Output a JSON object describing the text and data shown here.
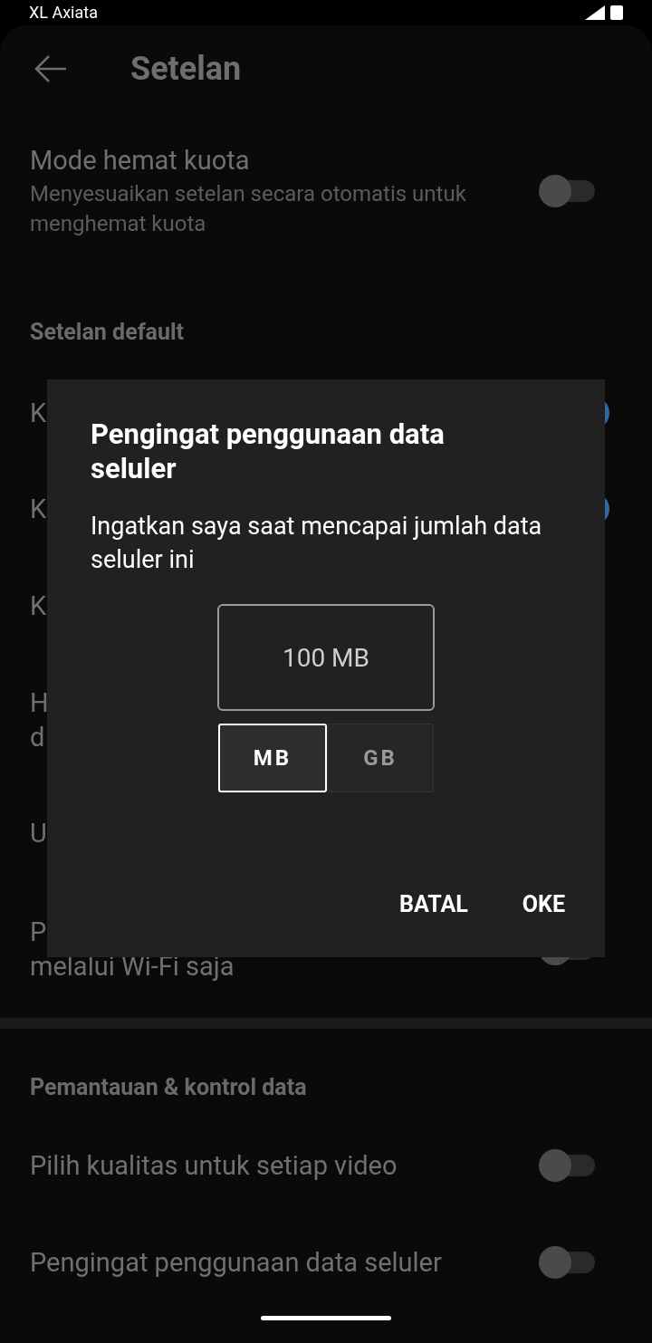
{
  "status_bar": {
    "carrier": "XL Axiata"
  },
  "app_bar": {
    "title": "Setelan"
  },
  "sections": [
    {
      "rows": [
        {
          "lines": [
            "Mode hemat kuota"
          ],
          "subtitle": "Menyesuaikan setelan secara otomatis untuk menghemat kuota",
          "toggle": {
            "on": false
          }
        }
      ]
    },
    {
      "header": "Setelan default",
      "rows": [
        {
          "lines": [
            "K"
          ],
          "toggle": {
            "on": true
          }
        },
        {
          "lines": [
            "K"
          ],
          "toggle": {
            "on": true
          }
        },
        {
          "lines": [
            "K"
          ]
        },
        {
          "lines": [
            "H",
            "d"
          ]
        },
        {
          "lines": [
            "U"
          ]
        },
        {
          "lines": [
            "P",
            "melalui Wi-Fi saja"
          ],
          "toggle": {
            "on": false
          }
        }
      ]
    },
    {
      "header": "Pemantauan & kontrol data",
      "rows": [
        {
          "lines": [
            "Pilih kualitas untuk setiap video"
          ],
          "toggle": {
            "on": false
          }
        },
        {
          "lines": [
            "Pengingat penggunaan data seluler"
          ],
          "toggle": {
            "on": false
          }
        }
      ]
    }
  ],
  "dialog": {
    "title": "Pengingat penggunaan data seluler",
    "message": "Ingatkan saya saat mencapai jumlah data seluler ini",
    "value": "100 MB",
    "units": [
      {
        "label": "MB",
        "selected": true
      },
      {
        "label": "GB",
        "selected": false
      }
    ],
    "buttons": [
      "BATAL",
      "OKE"
    ]
  }
}
